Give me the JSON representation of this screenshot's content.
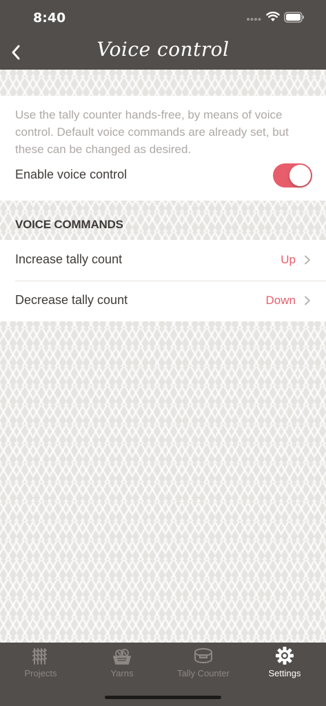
{
  "status_bar": {
    "time": "8:40"
  },
  "nav": {
    "title": "Voice control",
    "back_icon": "chevron-left-icon"
  },
  "intro": {
    "description": "Use the tally counter hands-free, by means of voice control. Default voice commands are already set, but these can be changed as desired.",
    "toggle_label": "Enable voice control",
    "toggle_on": true
  },
  "voice_commands": {
    "header": "VOICE COMMANDS",
    "rows": [
      {
        "label": "Increase tally count",
        "value": "Up"
      },
      {
        "label": "Decrease tally count",
        "value": "Down"
      }
    ]
  },
  "tabs": [
    {
      "label": "Projects",
      "icon": "knit-stitch-icon"
    },
    {
      "label": "Yarns",
      "icon": "yarn-basket-icon"
    },
    {
      "label": "Tally Counter",
      "icon": "row-counter-icon"
    },
    {
      "label": "Settings",
      "icon": "gear-icon"
    }
  ],
  "colors": {
    "bar": "#524e4b",
    "accent": "#e85d6b",
    "text": "#3e3a38",
    "muted_text": "#aea8a4",
    "inactive_tab": "#8d8884"
  }
}
